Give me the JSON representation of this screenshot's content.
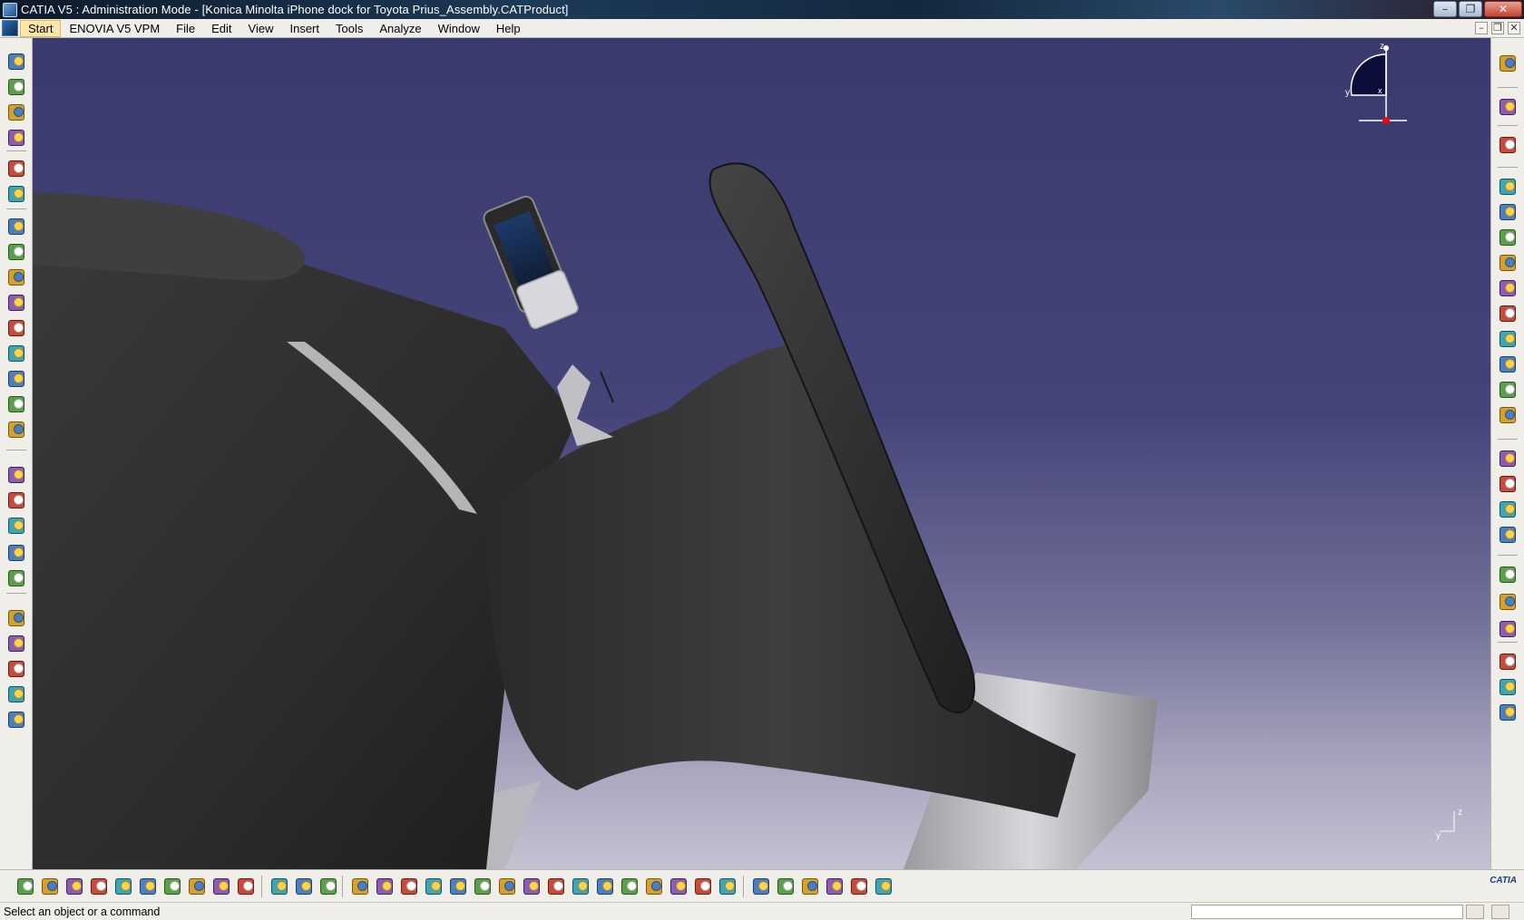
{
  "window": {
    "title": "CATIA V5 : Administration Mode - [Konica Minolta iPhone dock for Toyota Prius_Assembly.CATProduct]",
    "controls": [
      "minimize",
      "restore",
      "close"
    ]
  },
  "menubar": {
    "items": [
      {
        "label": "Start"
      },
      {
        "label": "ENOVIA V5 VPM"
      },
      {
        "label": "File"
      },
      {
        "label": "Edit"
      },
      {
        "label": "View"
      },
      {
        "label": "Insert"
      },
      {
        "label": "Tools"
      },
      {
        "label": "Analyze"
      },
      {
        "label": "Window"
      },
      {
        "label": "Help"
      }
    ]
  },
  "compass": {
    "axis_z": "z",
    "axis_y": "y",
    "axis_x": "x"
  },
  "mini_axis": {
    "axis_z": "z",
    "axis_y": "y"
  },
  "status": {
    "text": "Select an object or a command",
    "input_value": ""
  },
  "brand": {
    "logo_text": "CATIA"
  },
  "icons": {
    "left_toolbar": [
      "point-icon",
      "spline-icon",
      "arc-icon",
      "plane-icon",
      "sketch-icon",
      "sketch-positioned-icon",
      "product-icon",
      "component-icon",
      "existing-component-icon",
      "constraint-icon",
      "fix-icon",
      "snap-icon",
      "manipulate-icon",
      "explode-icon",
      "stop-clash-icon",
      "update-icon",
      "annotation-icon",
      "text-icon",
      "flag-note-icon",
      "weld-icon",
      "welding-planner-icon",
      "catalog-icon",
      "bill-of-materials-icon",
      "scenes-icon",
      "review-icon"
    ],
    "right_toolbar": [
      "knowledge-icon",
      "select-icon",
      "measure-icon",
      "workbench-icon",
      "product-structure-icon",
      "replace-component-icon",
      "graph-tree-icon",
      "generate-numbering-icon",
      "reorder-icon",
      "multi-instantiation-icon",
      "fast-multi-instantiation-icon",
      "define-multi-instantiation-icon",
      "reuse-pattern-icon",
      "manage-representations-icon",
      "sectioning-icon",
      "clash-icon",
      "distance-icon",
      "space-analysis-icon",
      "publish-icon",
      "assembly-features-icon",
      "split-icon",
      "hole-icon",
      "pocket-icon",
      "add-icon"
    ],
    "bottom_toolbar": [
      "new-icon",
      "open-icon",
      "save-icon",
      "print-icon",
      "cut-icon",
      "copy-icon",
      "paste-icon",
      "undo-icon",
      "redo-icon",
      "whats-this-icon",
      "formula-icon",
      "comment-icon",
      "tools-palette-icon",
      "table-icon",
      "tree-icon",
      "pan-icon",
      "fit-all-icon",
      "rotate-icon",
      "zoom-in-icon",
      "zoom-out-icon",
      "normal-view-icon",
      "iso-view-icon",
      "multi-view-icon",
      "hide-show-icon",
      "swap-space-icon",
      "shading-icon",
      "capture-icon",
      "catalog-browser-icon",
      "grid-icon",
      "apply-material-icon",
      "render-icon",
      "scene-icon",
      "measure-between-icon",
      "measure-item-icon",
      "measure-inertia-icon"
    ]
  }
}
